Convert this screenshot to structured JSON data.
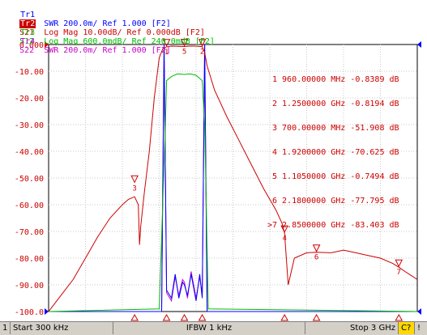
{
  "traces": [
    {
      "id": "Tr1",
      "text": "S11  SWR 200.0m/ Ref 1.000 [F2]",
      "color": "#0000ff",
      "active": false
    },
    {
      "id": "Tr2",
      "text": "S21  Log Mag 10.00dB/ Ref 0.000dB [F2]",
      "color": "#cc0000",
      "active": true
    },
    {
      "id": "Tr3",
      "text": "S12  Log Mag 600.0mdB/ Ref 240.0mdB [F2]",
      "color": "#00bb00",
      "active": false
    },
    {
      "id": "Tr4",
      "text": "S22  SWR 200.0m/ Ref 1.000 [F2]",
      "color": "#cc00cc",
      "active": false
    }
  ],
  "marker_table": [
    {
      "idx": "1",
      "text": "960.00000 MHz -0.8389 dB"
    },
    {
      "idx": "2",
      "text": "1.2500000 GHz -0.8194 dB"
    },
    {
      "idx": "3",
      "text": "700.00000 MHz -51.908 dB"
    },
    {
      "idx": "4",
      "text": "1.9200000 GHz -70.625 dB"
    },
    {
      "idx": "5",
      "text": "1.1050000 GHz -0.7494 dB"
    },
    {
      "idx": "6",
      "text": "2.1800000 GHz -77.795 dB"
    },
    {
      "idx": ">7",
      "text": "2.8500000 GHz -83.403 dB"
    }
  ],
  "y_ticks": [
    "0.000",
    "-10.00",
    "-20.00",
    "-30.00",
    "-40.00",
    "-50.00",
    "-60.00",
    "-70.00",
    "-80.00",
    "-90.00",
    "-100.0"
  ],
  "status": {
    "channel": "1",
    "start": "Start 300 kHz",
    "ifbw": "IFBW 1 kHz",
    "stop": "Stop 3 GHz",
    "cal": "C?",
    "warn": "!"
  },
  "chart_data": {
    "type": "line",
    "xlabel": "",
    "ylabel": "",
    "x_unit": "GHz",
    "xlim": [
      0.0003,
      3.0
    ],
    "ylim": [
      -100,
      0
    ],
    "grid": true,
    "series": [
      {
        "name": "S21",
        "color": "#cc0000",
        "x": [
          0.0003,
          0.1,
          0.2,
          0.3,
          0.4,
          0.5,
          0.6,
          0.65,
          0.7,
          0.73,
          0.74,
          0.75,
          0.78,
          0.82,
          0.86,
          0.9,
          0.93,
          0.96,
          1.0,
          1.05,
          1.105,
          1.15,
          1.2,
          1.25,
          1.27,
          1.29,
          1.35,
          1.45,
          1.55,
          1.65,
          1.75,
          1.85,
          1.9,
          1.92,
          1.95,
          2.0,
          2.1,
          2.18,
          2.3,
          2.4,
          2.5,
          2.6,
          2.7,
          2.8,
          2.85,
          2.9,
          3.0
        ],
        "y": [
          -100,
          -94,
          -88,
          -80,
          -72,
          -65,
          -60,
          -58,
          -57,
          -60,
          -75,
          -68,
          -55,
          -40,
          -20,
          -5,
          -1.5,
          -0.8389,
          -0.6,
          -0.7,
          -0.7494,
          -0.6,
          -0.6,
          -0.8194,
          -3,
          -8,
          -17,
          -27,
          -36,
          -45,
          -54,
          -62,
          -67,
          -70.625,
          -90,
          -80,
          -78,
          -77.795,
          -78,
          -77,
          -78,
          -79,
          -80,
          -82,
          -83.403,
          -85,
          -88
        ]
      },
      {
        "name": "S12",
        "color": "#00bb00",
        "x": [
          0.0003,
          0.9,
          0.95,
          0.96,
          1.0,
          1.05,
          1.105,
          1.15,
          1.2,
          1.25,
          1.27,
          1.3,
          3.0
        ],
        "y": [
          -100,
          -99,
          -30,
          -13.5,
          -12,
          -11,
          -11.2,
          -11,
          -11.5,
          -13.5,
          -30,
          -99,
          -100
        ]
      },
      {
        "name": "S11",
        "color": "#0000ff",
        "x": [
          0.0003,
          0.92,
          0.94,
          0.96,
          1.0,
          1.03,
          1.06,
          1.09,
          1.105,
          1.13,
          1.16,
          1.2,
          1.23,
          1.25,
          1.27,
          1.29,
          3.0
        ],
        "y": [
          -100,
          -100,
          0,
          -92,
          -95,
          -86,
          -95,
          -89,
          -90,
          -94,
          -86,
          -96,
          -86,
          -95,
          0,
          -100,
          -100
        ]
      },
      {
        "name": "S22",
        "color": "#cc00cc",
        "x": [
          0.0003,
          0.92,
          0.94,
          0.96,
          1.0,
          1.03,
          1.06,
          1.09,
          1.105,
          1.13,
          1.16,
          1.2,
          1.23,
          1.25,
          1.27,
          1.29,
          3.0
        ],
        "y": [
          -100,
          -100,
          0,
          -93,
          -96,
          -87,
          -94,
          -88,
          -89,
          -95,
          -85,
          -95,
          -87,
          -94,
          0,
          -100,
          -100
        ]
      }
    ],
    "markers": [
      {
        "label": "1",
        "x": 0.96,
        "y": -0.8389,
        "color": "#cc0000"
      },
      {
        "label": "2",
        "x": 1.25,
        "y": -0.8194,
        "color": "#cc0000"
      },
      {
        "label": "3",
        "x": 0.7,
        "y": -51.908,
        "color": "#cc0000"
      },
      {
        "label": "4",
        "x": 1.92,
        "y": -70.625,
        "color": "#cc0000"
      },
      {
        "label": "5",
        "x": 1.105,
        "y": -0.7494,
        "color": "#cc0000"
      },
      {
        "label": "6",
        "x": 2.18,
        "y": -77.795,
        "color": "#cc0000"
      },
      {
        "label": "7",
        "x": 2.85,
        "y": -83.403,
        "color": "#cc0000"
      }
    ]
  }
}
